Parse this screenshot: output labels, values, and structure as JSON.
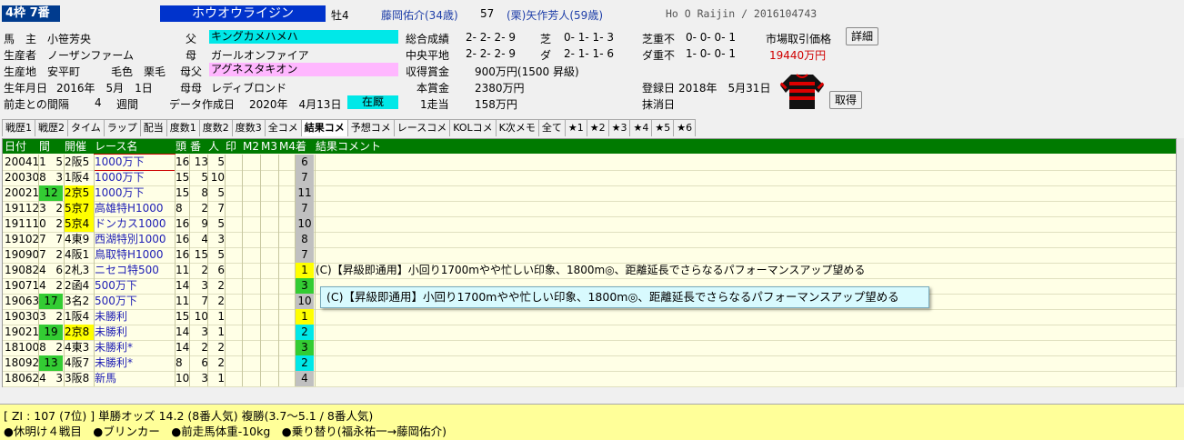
{
  "header": {
    "waku": "4枠 7番",
    "horse_name": "ホウオウライジン",
    "sex_age": "牡4",
    "jockey": "藤岡佑介(34歳)",
    "weight": "57",
    "trainer": "(栗)矢作芳人(59歳)",
    "romaji_id": "Ho O Raijin / 2016104743",
    "owner_label": "馬　主",
    "owner": "小笹芳央",
    "breeder_label": "生産者",
    "breeder": "ノーザンファーム",
    "birthplace_label": "生産地",
    "birthplace": "安平町",
    "coat_label": "毛色",
    "coat": "栗毛",
    "birthday_label": "生年月日",
    "birthday": "2016年　5月　1日",
    "interval_label": "前走との間隔",
    "interval_value": "4",
    "interval_unit": "週間",
    "sire_label": "父",
    "sire": "キングカメハメハ",
    "dam_label": "母",
    "dam": "ガールオンファイア",
    "damsire_label": "母父",
    "damsire": "アグネスタキオン",
    "granddam_label": "母母",
    "granddam": "レディブロンド",
    "data_date_label": "データ作成日",
    "data_date": "2020年　4月13日",
    "status": "在厩",
    "total_label": "総合成績",
    "total": "2- 2- 2- 9",
    "turf_label": "芝",
    "turf": "0- 1- 1- 3",
    "turf_bad_label": "芝重不",
    "turf_bad": "0- 0- 0- 1",
    "market_label": "市場取引価格",
    "detail_btn": "詳細",
    "central_label": "中央平地",
    "central": "2- 2- 2- 9",
    "dirt_label": "ダ",
    "dirt": "2- 1- 1- 6",
    "dirt_bad_label": "ダ重不",
    "dirt_bad": "1- 0- 0- 1",
    "market_price": "19440万円",
    "earned_label": "収得賞金",
    "earned": "900万円(1500 昇級)",
    "prize_label": "本賞金",
    "prize": "2380万円",
    "per_win_label": "1走当",
    "per_win": "158万円",
    "reg_label": "登録日",
    "reg_date": "2018年　5月31日",
    "erase_label": "抹消日",
    "cancel_btn": "取得"
  },
  "tabs": [
    "戦歴1",
    "戦歴2",
    "タイム",
    "ラップ",
    "配当",
    "度数1",
    "度数2",
    "度数3",
    "全コメ",
    "結果コメ",
    "予想コメ",
    "レースコメ",
    "KOLコメ",
    "K次メモ",
    "全て",
    "★1",
    "★2",
    "★3",
    "★4",
    "★5",
    "★6"
  ],
  "table": {
    "headers": [
      "日付",
      "間",
      "開催",
      "レース名",
      "頭",
      "番",
      "人",
      "印",
      "M2",
      "M3",
      "M4",
      "着",
      "結果コメント"
    ],
    "rows": [
      {
        "date": "200411",
        "kan": "5",
        "kaisai": "2阪5",
        "race": "1000万下",
        "heads": "16",
        "ban": "13",
        "pop": "5",
        "finish": "6",
        "comment": ""
      },
      {
        "date": "200308",
        "kan": "3",
        "kaisai": "1阪4",
        "race": "1000万下",
        "heads": "15",
        "ban": "5",
        "pop": "10",
        "finish": "7",
        "comment": ""
      },
      {
        "date": "200215",
        "kan": "12",
        "kaisai": "2京5",
        "race": "1000万下",
        "heads": "15",
        "ban": "8",
        "pop": "5",
        "finish": "11",
        "comment": ""
      },
      {
        "date": "191123",
        "kan": "2",
        "kaisai": "5京7",
        "race": "高雄特H1000",
        "heads": "8",
        "ban": "2",
        "pop": "7",
        "finish": "7",
        "comment": ""
      },
      {
        "date": "191110",
        "kan": "2",
        "kaisai": "5京4",
        "race": "ドンカス1000",
        "heads": "16",
        "ban": "9",
        "pop": "5",
        "finish": "10",
        "comment": ""
      },
      {
        "date": "191027",
        "kan": "7",
        "kaisai": "4東9",
        "race": "西湖特別1000",
        "heads": "16",
        "ban": "4",
        "pop": "3",
        "finish": "8",
        "comment": ""
      },
      {
        "date": "190907",
        "kan": "2",
        "kaisai": "4阪1",
        "race": "鳥取特H1000",
        "heads": "16",
        "ban": "15",
        "pop": "5",
        "finish": "7",
        "comment": ""
      },
      {
        "date": "190824",
        "kan": "6",
        "kaisai": "2札3",
        "race": "ニセコ特500",
        "heads": "11",
        "ban": "2",
        "pop": "6",
        "finish": "1",
        "comment": "(C)【昇級即通用】小回り1700mやや忙しい印象、1800m◎、距離延長でさらなるパフォーマンスアップ望める"
      },
      {
        "date": "190714",
        "kan": "2",
        "kaisai": "2函4",
        "race": "500万下",
        "heads": "14",
        "ban": "3",
        "pop": "2",
        "finish": "3",
        "comment": ""
      },
      {
        "date": "190630",
        "kan": "17",
        "kaisai": "3名2",
        "race": "500万下",
        "heads": "11",
        "ban": "7",
        "pop": "2",
        "finish": "10",
        "comment": ""
      },
      {
        "date": "190303",
        "kan": "2",
        "kaisai": "1阪4",
        "race": "未勝利",
        "heads": "15",
        "ban": "10",
        "pop": "1",
        "finish": "1",
        "comment": ""
      },
      {
        "date": "190217",
        "kan": "19",
        "kaisai": "2京8",
        "race": "未勝利",
        "heads": "14",
        "ban": "3",
        "pop": "1",
        "finish": "2",
        "comment": ""
      },
      {
        "date": "181008",
        "kan": "2",
        "kaisai": "4東3",
        "race": "未勝利*",
        "heads": "14",
        "ban": "2",
        "pop": "2",
        "finish": "3",
        "comment": ""
      },
      {
        "date": "180923",
        "kan": "13",
        "kaisai": "4阪7",
        "race": "未勝利*",
        "heads": "8",
        "ban": "6",
        "pop": "2",
        "finish": "2",
        "comment": ""
      },
      {
        "date": "180624",
        "kan": "3",
        "kaisai": "3阪8",
        "race": "新馬",
        "heads": "10",
        "ban": "3",
        "pop": "1",
        "finish": "4",
        "comment": ""
      }
    ]
  },
  "tooltip": "(C)【昇級即通用】小回り1700mやや忙しい印象、1800m◎、距離延長でさらなるパフォーマンスアップ望める",
  "footer": {
    "line1": "[ ZI :  107 (7位)    ]  単勝オッズ  14.2 (8番人気)  複勝(3.7～5.1 / 8番人気)",
    "line2": "●休明け４戦目　●ブリンカー　●前走馬体重-10kg　●乗り替り(福永祐一→藤岡佑介)"
  },
  "colors": {
    "header_green": "#007a00",
    "finish_1": "#ffff00",
    "finish_2": "#00e8e8",
    "finish_3": "#33cc33",
    "finish_other": "#c0c0c0",
    "kan_green": "#33cc33",
    "kaisai_yellow": "#ffff00"
  },
  "icons": {
    "jockey_silks": "jockey-silks-icon"
  }
}
